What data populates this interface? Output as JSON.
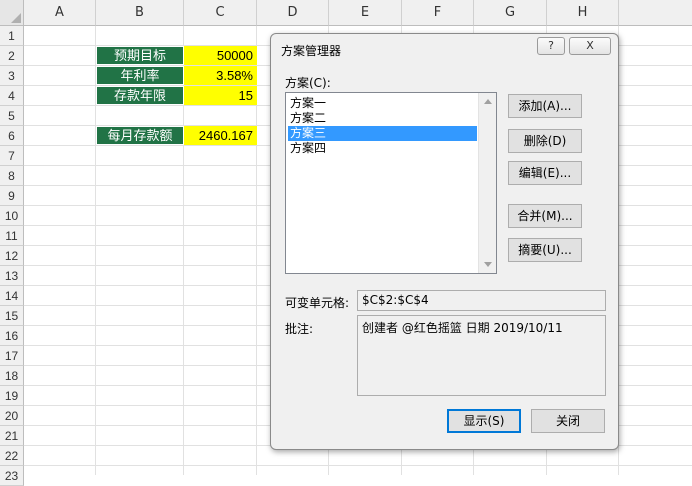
{
  "sheet": {
    "columns": [
      "A",
      "B",
      "C",
      "D",
      "E",
      "F",
      "G",
      "H"
    ],
    "rows": [
      "1",
      "2",
      "3",
      "4",
      "5",
      "6",
      "7",
      "8",
      "9",
      "10",
      "11",
      "12",
      "13",
      "14",
      "15",
      "16",
      "17",
      "18",
      "19",
      "20",
      "21",
      "22",
      "23"
    ],
    "cells": {
      "B2": "预期目标",
      "C2": "50000",
      "B3": "年利率",
      "C3": "3.58%",
      "B4": "存款年限",
      "C4": "15",
      "B6": "每月存款额",
      "C6": "2460.167"
    },
    "colors": {
      "label_bg": "#217346",
      "value_bg": "#ffff00"
    }
  },
  "dialog": {
    "title": "方案管理器",
    "help_button": "?",
    "close_button": "X",
    "list_label": "方案(C):",
    "scenarios": [
      "方案一",
      "方案二",
      "方案三",
      "方案四"
    ],
    "selected_index": 2,
    "buttons": {
      "add": "添加(A)...",
      "delete": "删除(D)",
      "edit": "编辑(E)...",
      "merge": "合并(M)...",
      "summary": "摘要(U)..."
    },
    "changing_cells_label": "可变单元格:",
    "changing_cells_value": "$C$2:$C$4",
    "comment_label": "批注:",
    "comment_value": "创建者 @红色摇篮 日期 2019/10/11",
    "show_button": "显示(S)",
    "close_label": "关闭",
    "accent": "#3399ff"
  }
}
